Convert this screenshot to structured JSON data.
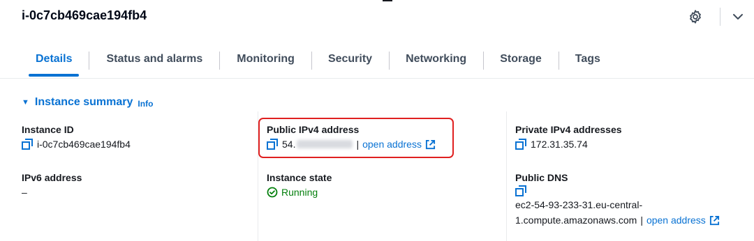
{
  "instance": {
    "title": "i-0c7cb469cae194fb4"
  },
  "header_icons": {
    "settings": "gear-icon",
    "collapse": "chevron-down-icon"
  },
  "tabs": [
    {
      "label": "Details",
      "active": true
    },
    {
      "label": "Status and alarms",
      "active": false
    },
    {
      "label": "Monitoring",
      "active": false
    },
    {
      "label": "Security",
      "active": false
    },
    {
      "label": "Networking",
      "active": false
    },
    {
      "label": "Storage",
      "active": false
    },
    {
      "label": "Tags",
      "active": false
    }
  ],
  "summary": {
    "title": "Instance summary",
    "info": "Info"
  },
  "fields": {
    "instance_id": {
      "label": "Instance ID",
      "value": "i-0c7cb469cae194fb4"
    },
    "ipv6": {
      "label": "IPv6 address",
      "value": "–"
    },
    "public_ipv4": {
      "label": "Public IPv4 address",
      "value_prefix": "54.",
      "separator": "|",
      "open_link": "open address"
    },
    "instance_state": {
      "label": "Instance state",
      "value": "Running"
    },
    "private_ipv4": {
      "label": "Private IPv4 addresses",
      "value": "172.31.35.74"
    },
    "public_dns": {
      "label": "Public DNS",
      "line1": "ec2-54-93-233-31.eu-central-",
      "line2": "1.compute.amazonaws.com",
      "separator": "|",
      "open_link": "open address"
    }
  },
  "colors": {
    "accent": "#0972d3",
    "success": "#037f0c",
    "highlight": "#e02020"
  }
}
